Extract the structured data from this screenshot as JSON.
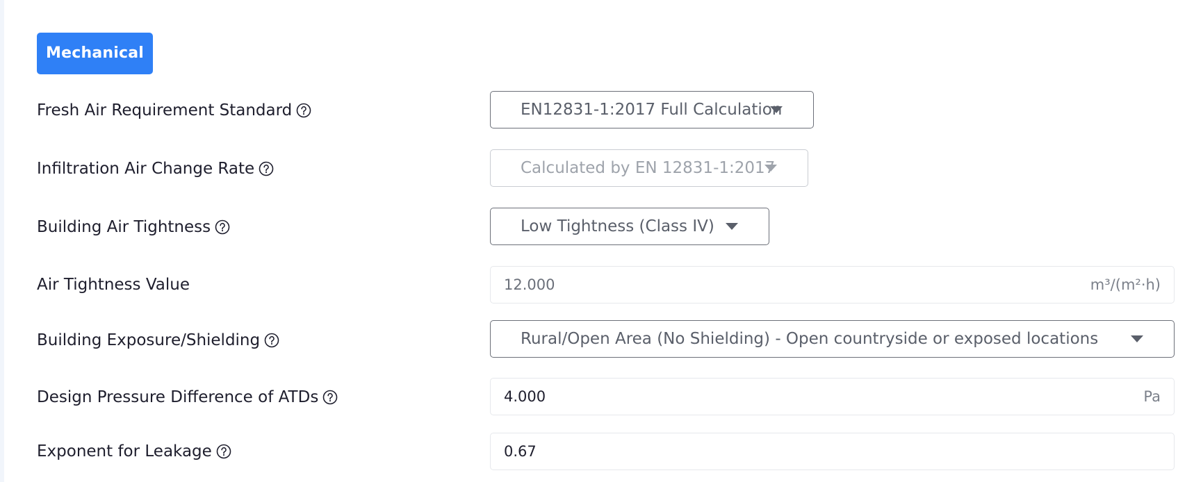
{
  "section": {
    "title": "Mechanical"
  },
  "fields": {
    "fresh_air_standard": {
      "label": "Fresh Air Requirement Standard",
      "value": "EN12831-1:2017 Full Calculation"
    },
    "infiltration_rate": {
      "label": "Infiltration Air Change Rate",
      "value": "Calculated by EN 12831-1:2017"
    },
    "building_air_tightness": {
      "label": "Building Air Tightness",
      "value": "Low Tightness (Class IV)"
    },
    "air_tightness_value": {
      "label": "Air Tightness Value",
      "value": "12.000",
      "unit": "m³/(m²·h)"
    },
    "exposure_shielding": {
      "label": "Building Exposure/Shielding",
      "value": "Rural/Open Area (No Shielding) - Open countryside or exposed locations"
    },
    "design_pressure_difference": {
      "label": "Design Pressure Difference of ATDs",
      "value": "4.000",
      "unit": "Pa"
    },
    "leakage_exponent": {
      "label": "Exponent for Leakage",
      "value": "0.67"
    }
  },
  "colors": {
    "accent": "#2f80f6",
    "text": "#1e1e2d",
    "muted": "#5a5f6a",
    "border": "#6b6f78"
  },
  "icons": {
    "help": "question-circle-icon",
    "caret": "caret-down-icon"
  }
}
